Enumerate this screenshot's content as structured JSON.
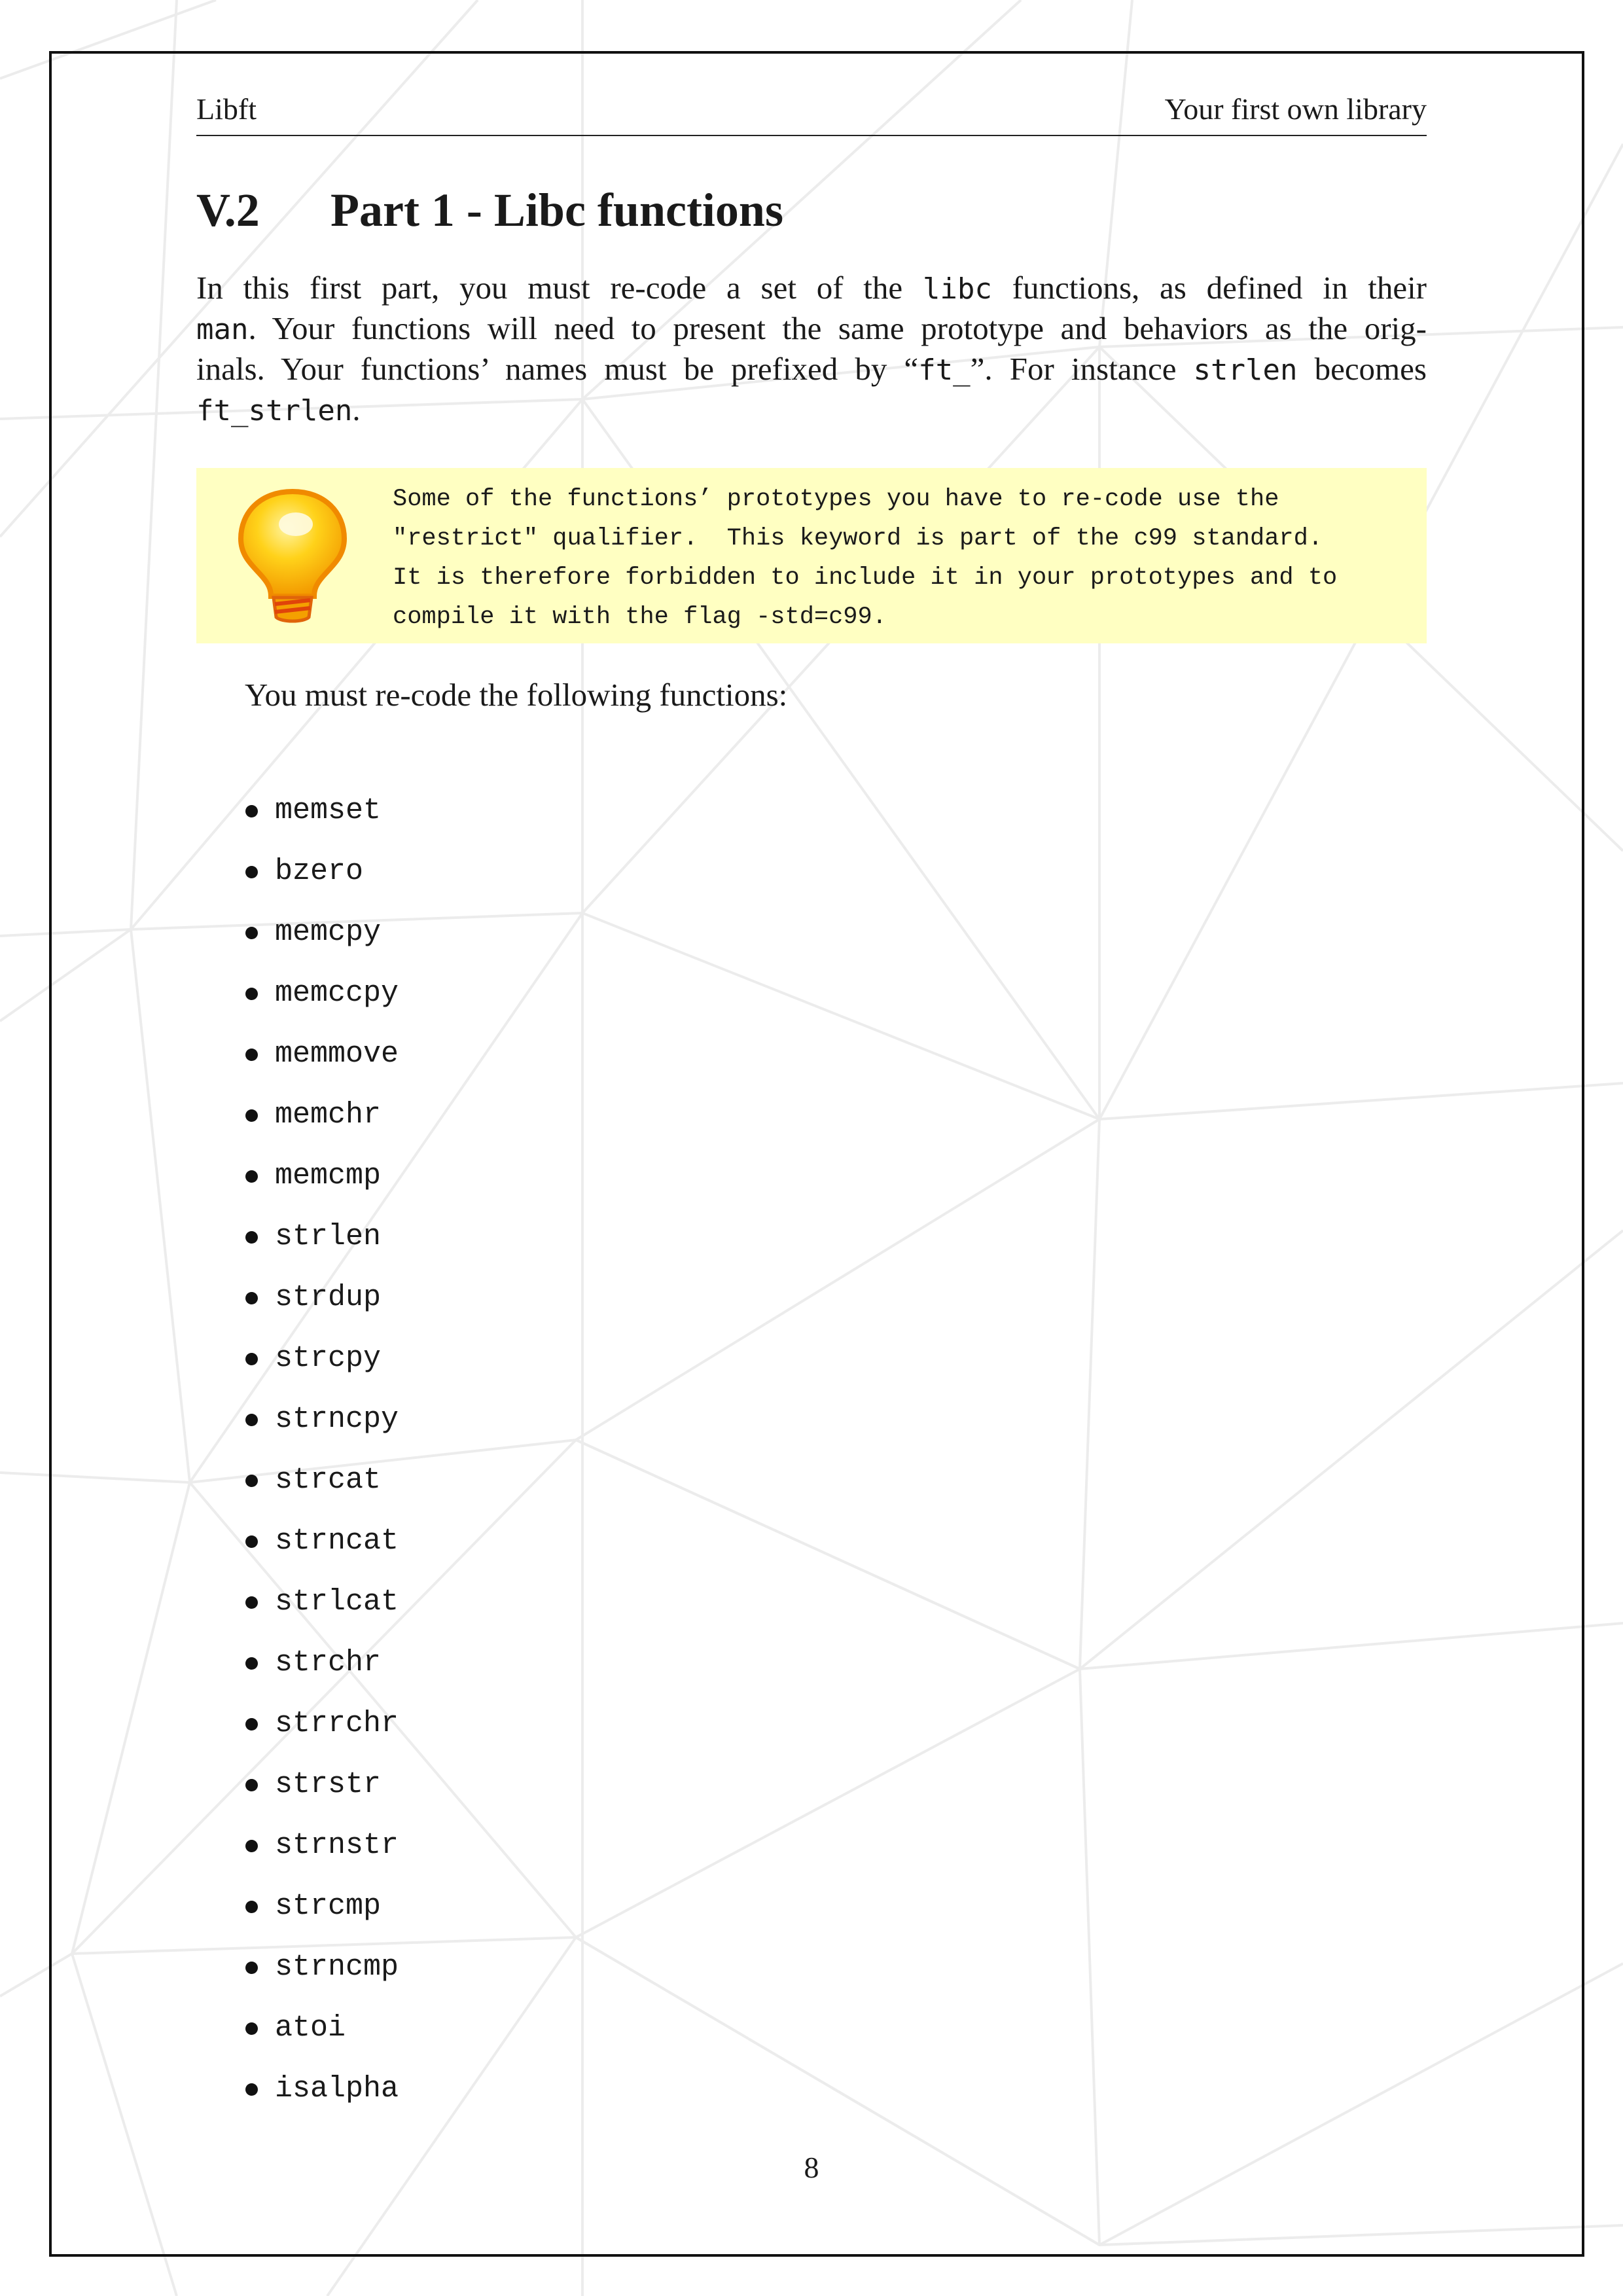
{
  "header": {
    "left": "Libft",
    "right": "Your first own library"
  },
  "section": {
    "number": "V.2",
    "title": "Part 1 - Libc functions"
  },
  "intro": {
    "t1": "In this first part, you must re-code a set of the ",
    "c1": "libc",
    "t2": " functions, as defined in their",
    "c2": "man",
    "t3": ". Your functions will need to present the same prototype and behaviors as the orig-",
    "t4": "inals. Your functions’ names must be prefixed by “",
    "c3": "ft_",
    "t5": "”. For instance ",
    "c4": "strlen",
    "t6": " becomes",
    "c5": "ft_strlen",
    "t7": "."
  },
  "tip": {
    "icon": "lightbulb-icon",
    "lines": [
      "Some of the functions’ prototypes you have to re-code use the",
      "\"restrict\" qualifier.  This keyword is part of the c99 standard.",
      "It is therefore forbidden to include it in your prototypes and to",
      "compile it with the flag -std=c99."
    ]
  },
  "lead": "You must re-code the following functions:",
  "functions": [
    "memset",
    "bzero",
    "memcpy",
    "memccpy",
    "memmove",
    "memchr",
    "memcmp",
    "strlen",
    "strdup",
    "strcpy",
    "strncpy",
    "strcat",
    "strncat",
    "strlcat",
    "strchr",
    "strrchr",
    "strstr",
    "strnstr",
    "strcmp",
    "strncmp",
    "atoi",
    "isalpha"
  ],
  "page_number": "8",
  "colors": {
    "tip_background": "#ffffc2",
    "background_lines": "#ececec"
  }
}
